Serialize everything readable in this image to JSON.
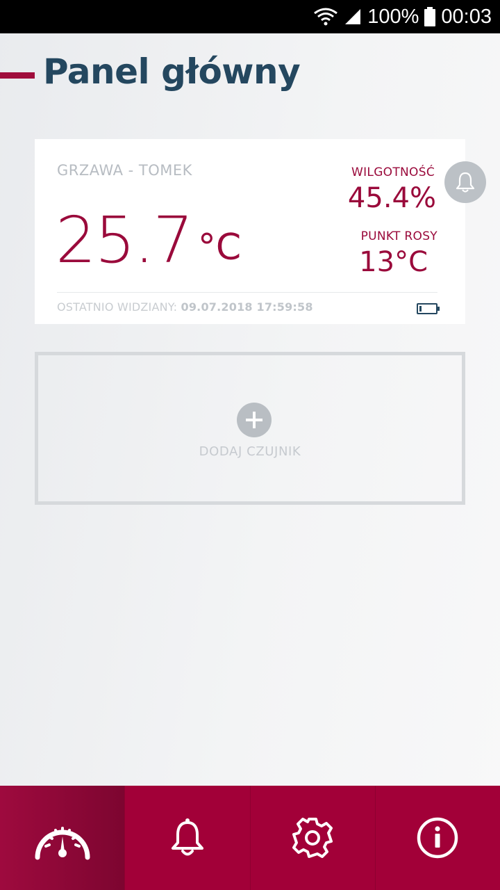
{
  "status_bar": {
    "battery_percent": "100%",
    "time": "00:03",
    "icons": [
      "wifi-icon",
      "signal-icon",
      "battery-icon"
    ]
  },
  "header": {
    "title": "Panel główny"
  },
  "sensor": {
    "name": "GRZAWA - TOMEK",
    "temperature": "25.7",
    "temperature_unit": "°C",
    "humidity_label": "WILGOTNOŚĆ",
    "humidity_value": "45.4%",
    "dew_point_label": "PUNKT ROSY",
    "dew_point_value": "13°C",
    "last_seen_label": "OSTATNIO WIDZIANY:",
    "last_seen_value": "09.07.2018 17:59:58",
    "battery_level": 0.1,
    "alarm_icon": "bell-icon"
  },
  "add_sensor": {
    "label": "DODAJ CZUJNIK",
    "icon": "plus-icon"
  },
  "bottom_nav": {
    "items": [
      {
        "name": "dashboard",
        "icon": "gauge-icon",
        "active": true
      },
      {
        "name": "alarms",
        "icon": "bell-icon",
        "active": false
      },
      {
        "name": "settings",
        "icon": "gear-icon",
        "active": false
      },
      {
        "name": "info",
        "icon": "info-icon",
        "active": false
      }
    ]
  },
  "colors": {
    "accent": "#a20038",
    "title": "#24475f",
    "value": "#9a0a3b",
    "muted": "#b7bcc2"
  }
}
